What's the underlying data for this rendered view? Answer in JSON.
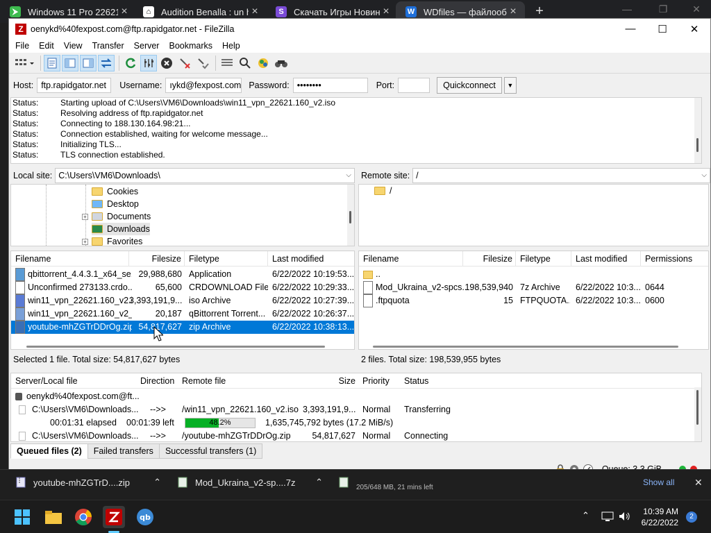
{
  "browser": {
    "tabs": [
      {
        "icon": "cursor-icon",
        "title": "Windows 11 Pro 22621"
      },
      {
        "icon": "library-icon",
        "title": "Audition Benalla : un h"
      },
      {
        "icon": "letter-s-icon",
        "title": "Скачать Игры Новинк"
      },
      {
        "icon": "wdfiles-icon",
        "title": "WDfiles — файлообм"
      }
    ]
  },
  "window": {
    "title": "oenykd%40fexpost.com@ftp.rapidgator.net - FileZilla"
  },
  "menu": [
    "File",
    "Edit",
    "View",
    "Transfer",
    "Server",
    "Bookmarks",
    "Help"
  ],
  "toolbar": {
    "icons": [
      "site-manager-icon",
      "toggle-log-icon",
      "toggle-local-tree-icon",
      "toggle-remote-tree-icon",
      "toggle-queue-icon",
      "refresh-icon",
      "process-queue-icon",
      "cancel-icon",
      "disconnect-icon",
      "reconnect-icon",
      "filter-icon",
      "search-remote-icon",
      "compare-icon",
      "find-files-icon"
    ]
  },
  "quickconnect": {
    "host_label": "Host:",
    "host": "ftp.rapidgator.net",
    "username_label": "Username:",
    "username": "ıykd@fexpost.com",
    "password_label": "Password:",
    "password": "••••••••",
    "port_label": "Port:",
    "port": "",
    "button": "Quickconnect"
  },
  "log": [
    {
      "kind": "Status:",
      "text": "Starting upload of C:\\Users\\VM6\\Downloads\\win11_vpn_22621.160_v2.iso"
    },
    {
      "kind": "Status:",
      "text": "Resolving address of ftp.rapidgator.net"
    },
    {
      "kind": "Status:",
      "text": "Connecting to 188.130.164.98:21..."
    },
    {
      "kind": "Status:",
      "text": "Connection established, waiting for welcome message..."
    },
    {
      "kind": "Status:",
      "text": "Initializing TLS..."
    },
    {
      "kind": "Status:",
      "text": "TLS connection established."
    }
  ],
  "local": {
    "label": "Local site:",
    "path": "C:\\Users\\VM6\\Downloads\\",
    "tree": [
      {
        "name": "Cookies",
        "icon": "folder-icon"
      },
      {
        "name": "Desktop",
        "icon": "desktop-folder-icon"
      },
      {
        "name": "Documents",
        "icon": "documents-folder-icon"
      },
      {
        "name": "Downloads",
        "icon": "downloads-folder-icon"
      },
      {
        "name": "Favorites",
        "icon": "folder-icon"
      }
    ],
    "columns": [
      "Filename",
      "Filesize",
      "Filetype",
      "Last modified"
    ],
    "files": [
      {
        "name": "qbittorrent_4.4.3.1_x64_se...",
        "size": "29,988,680",
        "type": "Application",
        "modified": "6/22/2022 10:19:53..."
      },
      {
        "name": "Unconfirmed 273133.crdo...",
        "size": "65,600",
        "type": "CRDOWNLOAD File",
        "modified": "6/22/2022 10:29:33..."
      },
      {
        "name": "win11_vpn_22621.160_v2.i...",
        "size": "3,393,191,9...",
        "type": "iso Archive",
        "modified": "6/22/2022 10:27:39..."
      },
      {
        "name": "win11_vpn_22621.160_v2_...",
        "size": "20,187",
        "type": "qBittorrent Torrent...",
        "modified": "6/22/2022 10:26:37..."
      },
      {
        "name": "youtube-mhZGTrDDrOg.zip",
        "size": "54,817,627",
        "type": "zip Archive",
        "modified": "6/22/2022 10:38:13..."
      }
    ],
    "status": "Selected 1 file. Total size: 54,817,627 bytes"
  },
  "remote": {
    "label": "Remote site:",
    "path": "/",
    "tree": [
      {
        "name": "/",
        "icon": "folder-icon"
      }
    ],
    "columns": [
      "Filename",
      "Filesize",
      "Filetype",
      "Last modified",
      "Permissions"
    ],
    "files": [
      {
        "name": "..",
        "size": "",
        "type": "",
        "modified": "",
        "perms": ""
      },
      {
        "name": "Mod_Ukraina_v2-spcs...",
        "size": "198,539,940",
        "type": "7z Archive",
        "modified": "6/22/2022 10:3...",
        "perms": "0644"
      },
      {
        "name": ".ftpquota",
        "size": "15",
        "type": "FTPQUOTA...",
        "modified": "6/22/2022 10:3...",
        "perms": "0600"
      }
    ],
    "status": "2 files. Total size: 198,539,955 bytes"
  },
  "queue": {
    "columns": [
      "Server/Local file",
      "Direction",
      "Remote file",
      "Size",
      "Priority",
      "Status"
    ],
    "server": "oenykd%40fexpost.com@ft...",
    "items": [
      {
        "local": "C:\\Users\\VM6\\Downloads...",
        "direction": "-->>",
        "remote": "/win11_vpn_22621.160_v2.iso",
        "size": "3,393,191,9...",
        "priority": "Normal",
        "status": "Transferring"
      },
      {
        "local": "C:\\Users\\VM6\\Downloads...",
        "direction": "-->>",
        "remote": "/youtube-mhZGTrDDrOg.zip",
        "size": "54,817,627",
        "priority": "Normal",
        "status": "Connecting"
      }
    ],
    "progress": {
      "elapsed": "00:01:31 elapsed",
      "left": "00:01:39 left",
      "percent": 48.2,
      "percent_label": "48.2%",
      "bytes": "1,635,745,792 bytes (17.2 MiB/s)"
    },
    "tabs": [
      "Queued files (2)",
      "Failed transfers",
      "Successful transfers (1)"
    ],
    "status_text": "Queue: 3.3 GiB"
  },
  "downloads": [
    {
      "name": "youtube-mhZGTrD....zip"
    },
    {
      "name": "Mod_Ukraina_v2-sp....7z"
    },
    {
      "name": "205/648 MB, 21 mins left"
    }
  ],
  "downloads_show_all": "Show all",
  "taskbar": {
    "time": "10:39 AM",
    "date": "6/22/2022",
    "notifications": "2"
  },
  "colors": {
    "accent": "#0078d7",
    "progress": "#06b025",
    "filezilla": "#bf0000"
  }
}
